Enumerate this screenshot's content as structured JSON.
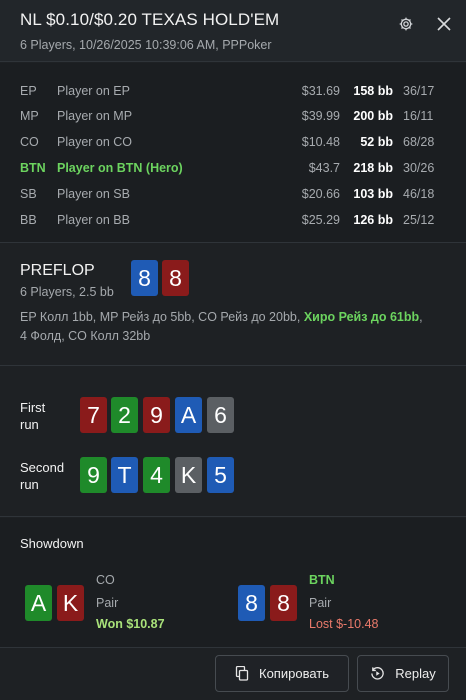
{
  "header": {
    "title": "NL $0.10/$0.20 TEXAS HOLD'EM",
    "subtitle": "6 Players, 10/26/2025 10:39:06 AM, PPPoker"
  },
  "players": [
    {
      "pos": "EP",
      "name": "Player on EP",
      "money": "$31.69",
      "bb": "158 bb",
      "ratio": "36/17",
      "hero": false
    },
    {
      "pos": "MP",
      "name": "Player on MP",
      "money": "$39.99",
      "bb": "200 bb",
      "ratio": "16/11",
      "hero": false
    },
    {
      "pos": "CO",
      "name": "Player on CO",
      "money": "$10.48",
      "bb": "52 bb",
      "ratio": "68/28",
      "hero": false
    },
    {
      "pos": "BTN",
      "name": "Player on BTN (Hero)",
      "money": "$43.7",
      "bb": "218 bb",
      "ratio": "30/26",
      "hero": true
    },
    {
      "pos": "SB",
      "name": "Player on SB",
      "money": "$20.66",
      "bb": "103 bb",
      "ratio": "46/18",
      "hero": false
    },
    {
      "pos": "BB",
      "name": "Player on BB",
      "money": "$25.29",
      "bb": "126 bb",
      "ratio": "25/12",
      "hero": false
    }
  ],
  "preflop": {
    "title": "PREFLOP",
    "subtitle": "6 Players, 2.5 bb",
    "hero_cards": [
      {
        "rank": "8",
        "color": "blue"
      },
      {
        "rank": "8",
        "color": "red"
      }
    ],
    "action_pre": "EP Колл 1bb, MP Рейз до 5bb, CO Рейз до 20bb, ",
    "action_hero": "Хиро Рейз до 61bb",
    "action_post": ",",
    "action_line2": "4 Фолд, CO Колл 32bb"
  },
  "runs": {
    "first_label_1": "First",
    "first_label_2": "run",
    "second_label_1": "Second",
    "second_label_2": "run",
    "first": [
      {
        "rank": "7",
        "color": "red"
      },
      {
        "rank": "2",
        "color": "green"
      },
      {
        "rank": "9",
        "color": "red"
      },
      {
        "rank": "A",
        "color": "blue"
      },
      {
        "rank": "6",
        "color": "gray"
      }
    ],
    "second": [
      {
        "rank": "9",
        "color": "green"
      },
      {
        "rank": "T",
        "color": "blue"
      },
      {
        "rank": "4",
        "color": "green"
      },
      {
        "rank": "K",
        "color": "gray"
      },
      {
        "rank": "5",
        "color": "blue"
      }
    ]
  },
  "showdown": {
    "title": "Showdown",
    "left": {
      "cards": [
        {
          "rank": "A",
          "color": "green"
        },
        {
          "rank": "K",
          "color": "red"
        }
      ],
      "pos": "CO",
      "hand": "Pair",
      "result": "Won $10.87"
    },
    "right": {
      "cards": [
        {
          "rank": "8",
          "color": "blue"
        },
        {
          "rank": "8",
          "color": "red"
        }
      ],
      "pos": "BTN",
      "hand": "Pair",
      "result": "Lost $-10.48"
    }
  },
  "footer": {
    "copy_label": "Копировать",
    "replay_label": "Replay"
  },
  "icons": {
    "settings": "gear-icon",
    "close": "close-icon",
    "copy": "copy-icon",
    "replay": "replay-icon"
  },
  "colors": {
    "hero_green": "#6cd45f",
    "won_green": "#a9e27a",
    "lost_red": "#ea7a6b",
    "card_blue": "#1f5bb5",
    "card_red": "#8a1b1b",
    "card_green": "#1f8a2a",
    "card_gray": "#5b5f63"
  }
}
